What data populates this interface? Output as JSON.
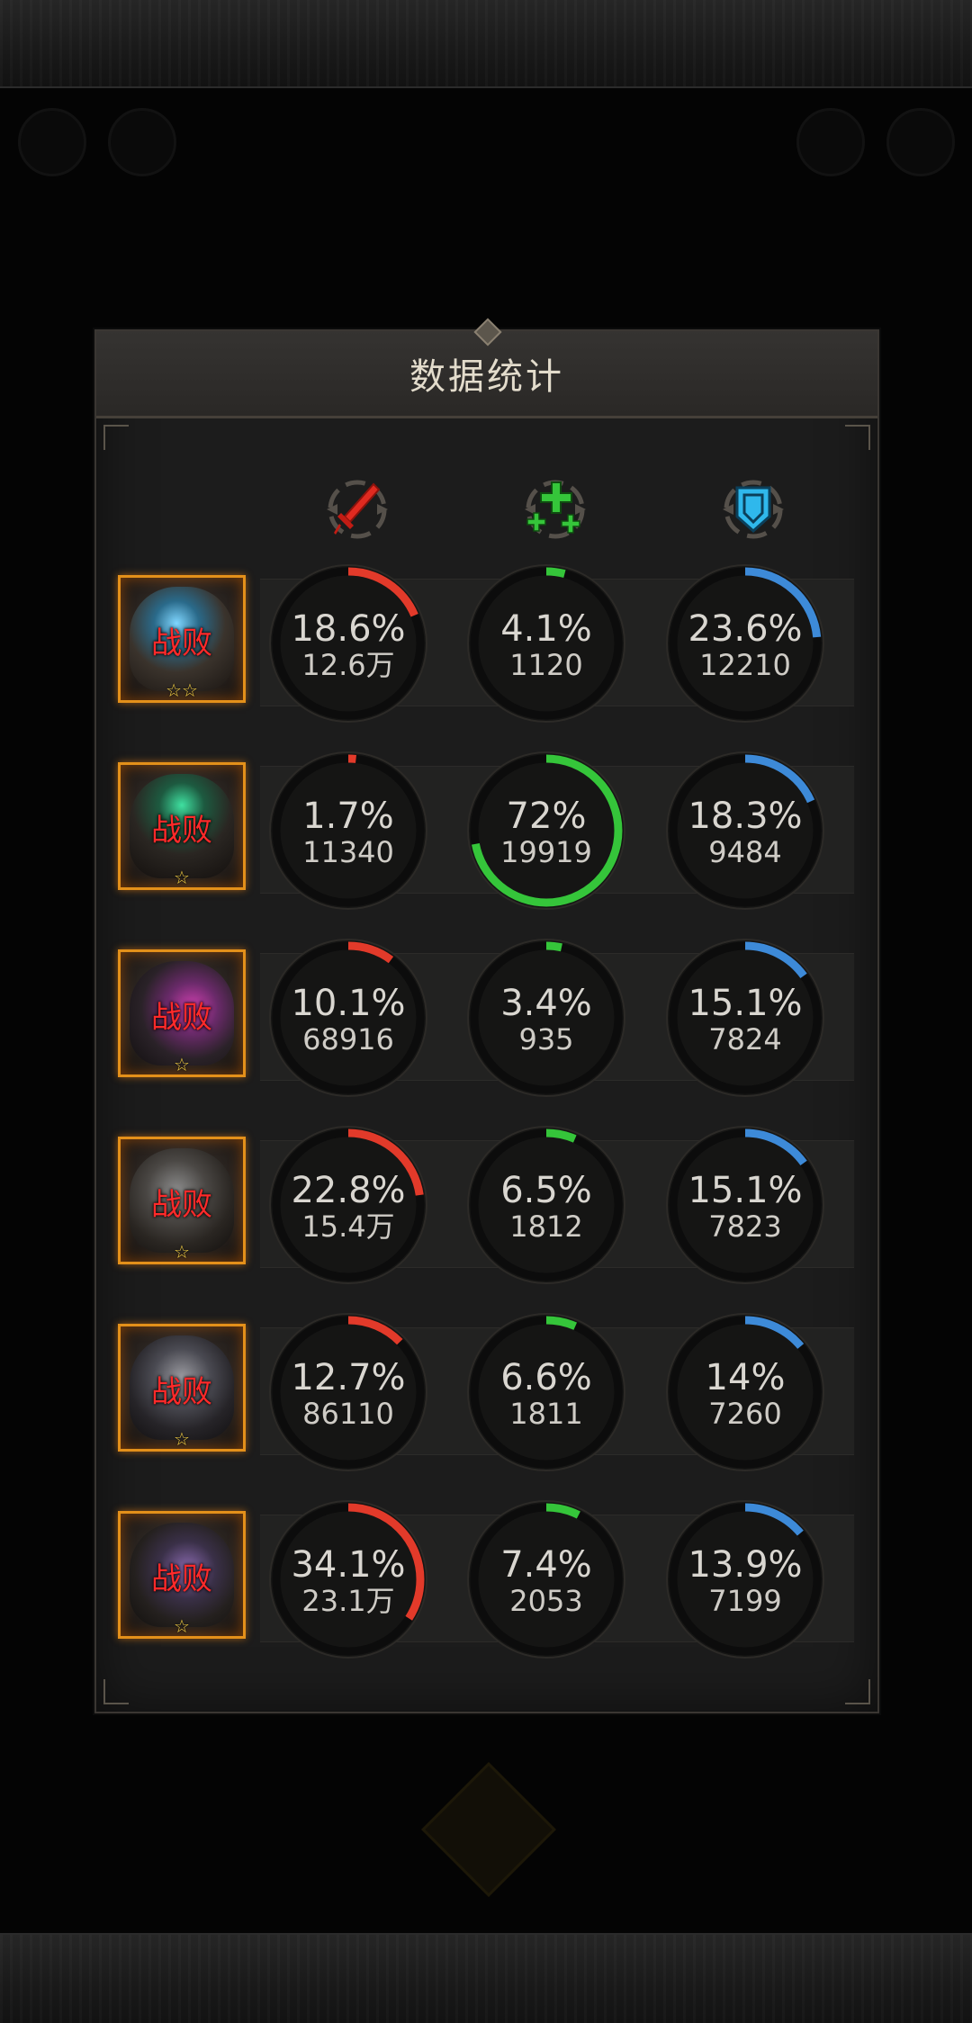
{
  "panel": {
    "title": "数据统计"
  },
  "columns": [
    {
      "icon": "sword-damage-icon",
      "color": "#e23a2a"
    },
    {
      "icon": "heal-cross-icon",
      "color": "#35c53a"
    },
    {
      "icon": "shield-defense-icon",
      "color": "#3d8ad8"
    }
  ],
  "rows": [
    {
      "status": "战败",
      "stars": "☆☆",
      "damage": {
        "pct": "18.6%",
        "value": "12.6万",
        "fraction": 0.186
      },
      "heal": {
        "pct": "4.1%",
        "value": "1120",
        "fraction": 0.041
      },
      "defense": {
        "pct": "23.6%",
        "value": "12210",
        "fraction": 0.236
      }
    },
    {
      "status": "战败",
      "stars": "☆",
      "damage": {
        "pct": "1.7%",
        "value": "11340",
        "fraction": 0.017
      },
      "heal": {
        "pct": "72%",
        "value": "19919",
        "fraction": 0.72
      },
      "defense": {
        "pct": "18.3%",
        "value": "9484",
        "fraction": 0.183
      }
    },
    {
      "status": "战败",
      "stars": "☆",
      "damage": {
        "pct": "10.1%",
        "value": "68916",
        "fraction": 0.101
      },
      "heal": {
        "pct": "3.4%",
        "value": "935",
        "fraction": 0.034
      },
      "defense": {
        "pct": "15.1%",
        "value": "7824",
        "fraction": 0.151
      }
    },
    {
      "status": "战败",
      "stars": "☆",
      "damage": {
        "pct": "22.8%",
        "value": "15.4万",
        "fraction": 0.228
      },
      "heal": {
        "pct": "6.5%",
        "value": "1812",
        "fraction": 0.065
      },
      "defense": {
        "pct": "15.1%",
        "value": "7823",
        "fraction": 0.151
      }
    },
    {
      "status": "战败",
      "stars": "☆",
      "damage": {
        "pct": "12.7%",
        "value": "86110",
        "fraction": 0.127
      },
      "heal": {
        "pct": "6.6%",
        "value": "1811",
        "fraction": 0.066
      },
      "defense": {
        "pct": "14%",
        "value": "7260",
        "fraction": 0.14
      }
    },
    {
      "status": "战败",
      "stars": "☆",
      "damage": {
        "pct": "34.1%",
        "value": "23.1万",
        "fraction": 0.341
      },
      "heal": {
        "pct": "7.4%",
        "value": "2053",
        "fraction": 0.074
      },
      "defense": {
        "pct": "13.9%",
        "value": "7199",
        "fraction": 0.139
      }
    }
  ]
}
